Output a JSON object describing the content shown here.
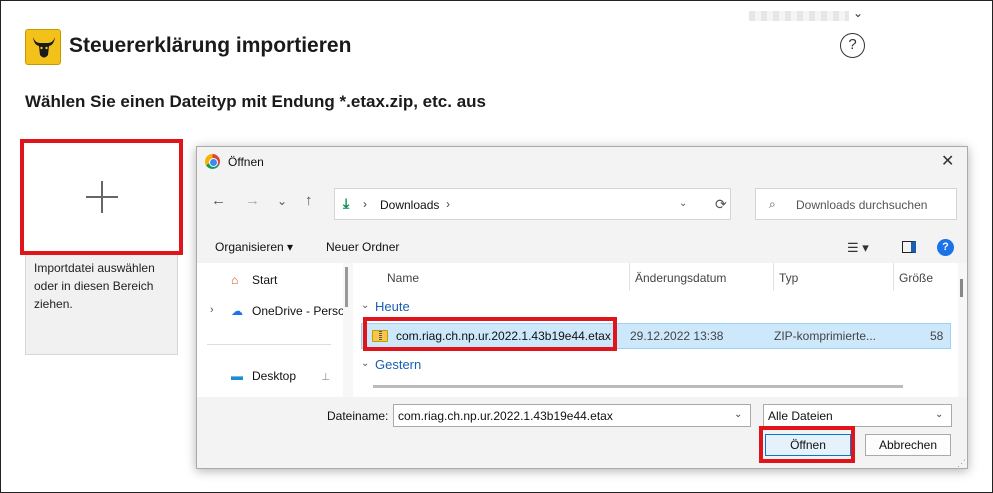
{
  "app": {
    "title": "Steuererklärung importieren",
    "subtitle": "Wählen Sie einen Dateityp mit Endung *.etax.zip, etc. aus",
    "help_icon": "?",
    "user_chevron": "⌄"
  },
  "dropzone": {
    "hint": "Importdatei auswählen\noder in diesen Bereich\nziehen."
  },
  "dialog": {
    "title": "Öffnen",
    "close": "✕",
    "nav": {
      "back": "←",
      "forward": "→",
      "history": "⌄",
      "up": "↑"
    },
    "address": {
      "segment": "Downloads",
      "sep": "›"
    },
    "search_placeholder": "Downloads durchsuchen",
    "toolbar": {
      "organize": "Organisieren ▾",
      "new_folder": "Neuer Ordner",
      "view": "☰ ▾",
      "help": "?"
    },
    "nav_pane": [
      {
        "label": "Start",
        "icon": "home-icon"
      },
      {
        "label": "OneDrive - Perso",
        "icon": "cloud-icon"
      },
      {
        "label": "Desktop",
        "icon": "desktop-icon",
        "pin": "📌"
      }
    ],
    "columns": [
      "Name",
      "Änderungsdatum",
      "Typ",
      "Größe"
    ],
    "groups": [
      "Heute",
      "Gestern"
    ],
    "files": [
      {
        "name": "com.riag.ch.np.ur.2022.1.43b19e44.etax",
        "date": "29.12.2022 13:38",
        "type": "ZIP-komprimierte...",
        "size": "58"
      }
    ],
    "filename_label": "Dateiname:",
    "filename_value": "com.riag.ch.np.ur.2022.1.43b19e44.etax",
    "filter_value": "Alle Dateien",
    "open_label": "Öffnen",
    "cancel_label": "Abbrechen"
  },
  "colors": {
    "highlight": "#e0141b",
    "accent": "#1a5fb4",
    "logo": "#f2c21a"
  }
}
